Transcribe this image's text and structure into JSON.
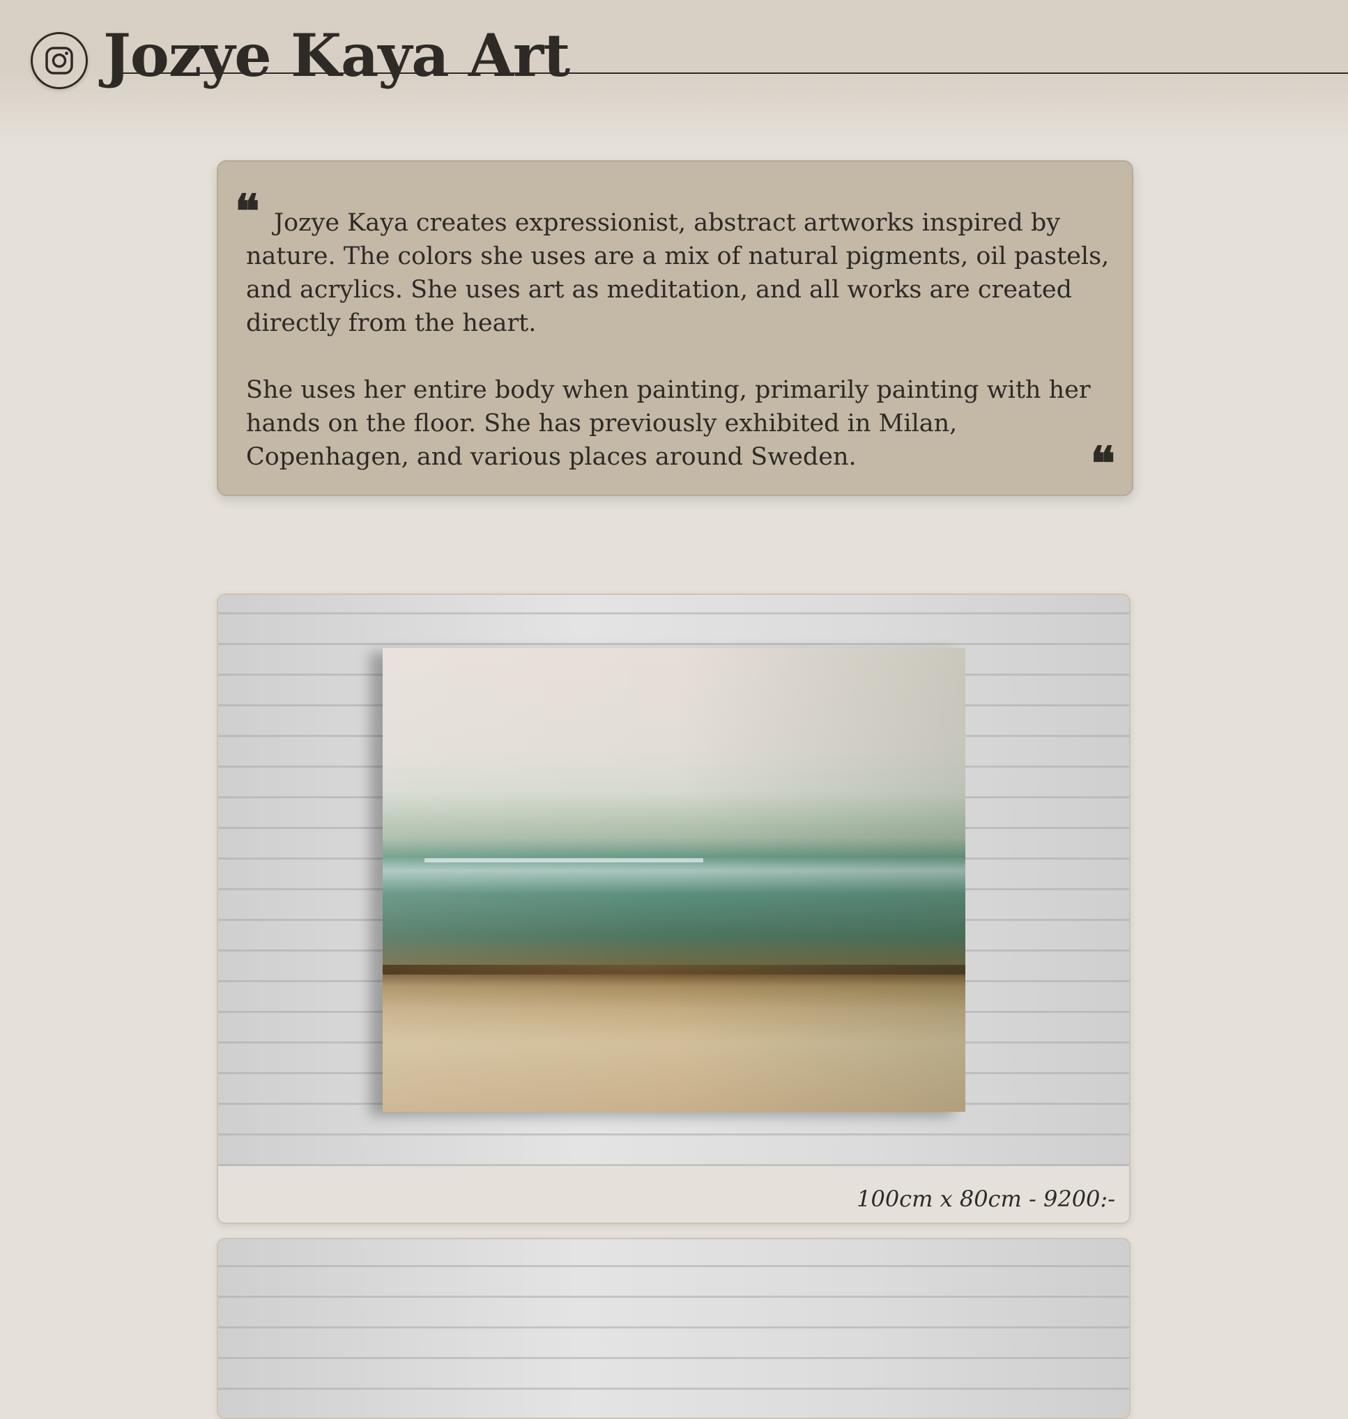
{
  "header": {
    "title": "Jozye Kaya Art",
    "instagram_icon": "instagram-icon"
  },
  "about": {
    "paragraph_1": "Jozye Kaya creates expressionist, abstract artworks inspired by nature. The colors she uses are a mix of natural pigments, oil pastels, and acrylics. She uses art as meditation, and all works are created directly from the heart.",
    "paragraph_2": "She uses her entire body when painting, primarily painting with her hands on the floor. She has previously exhibited in Milan, Copenhagen, and various places around Sweden.",
    "open_quote": "❝",
    "close_quote": "❝"
  },
  "artworks": [
    {
      "caption": "100cm x 80cm - 9200:-"
    }
  ],
  "colors": {
    "background": "#e5e1da",
    "header": "#d8d0c5",
    "quote_card": "#c4b8a6",
    "text": "#2e2a25"
  }
}
